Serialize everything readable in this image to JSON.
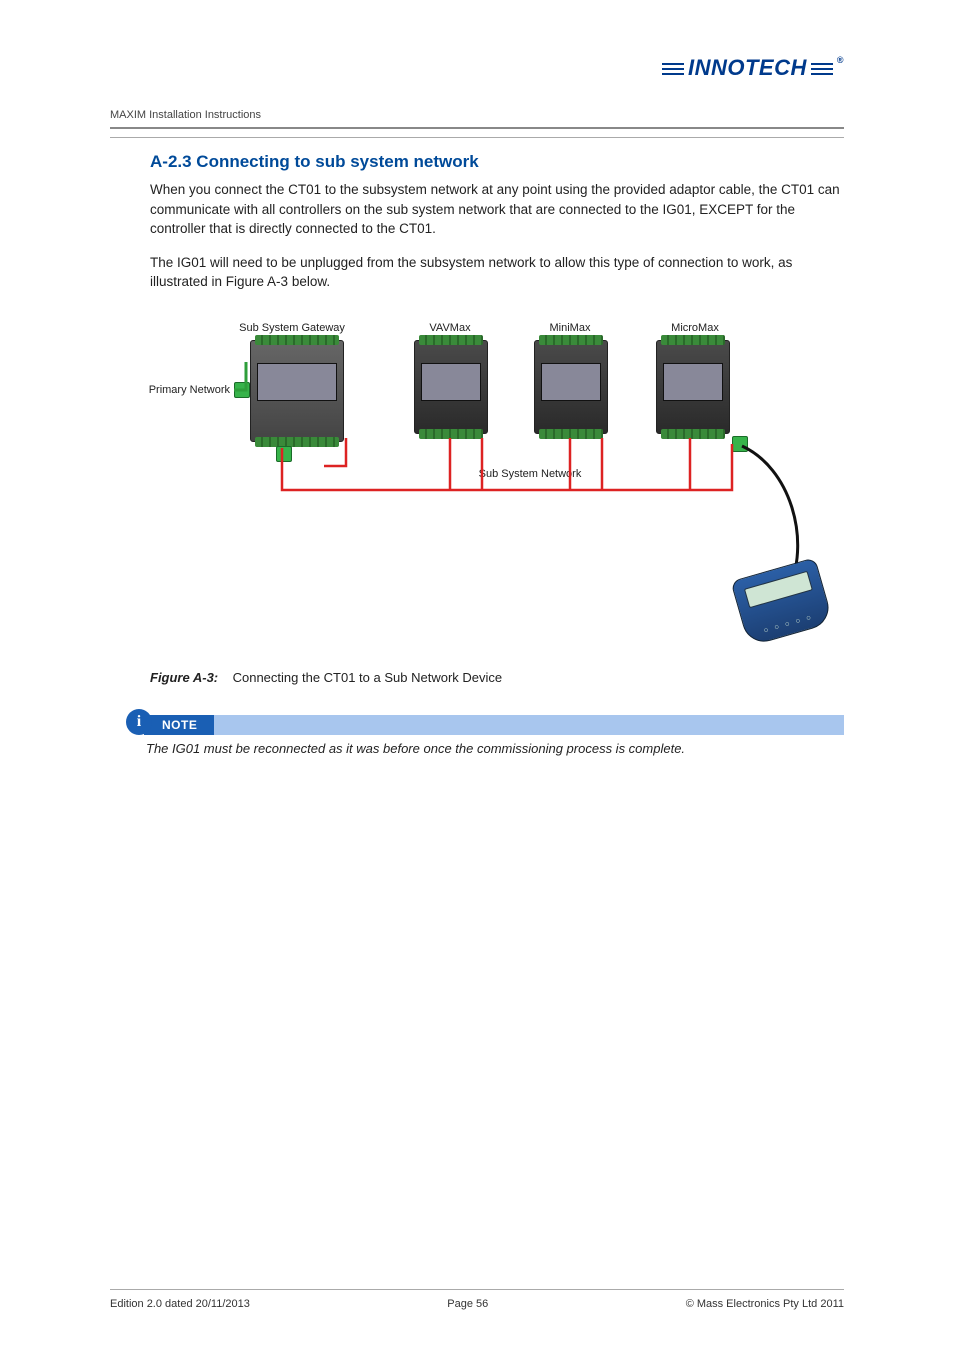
{
  "brand": "INNOTECH",
  "doc_header": "MAXIM Installation Instructions",
  "section": {
    "number_title": "A-2.3  Connecting to sub system network",
    "para1": "When you connect the CT01 to the subsystem network at any point using the provided adaptor cable, the CT01 can communicate with all controllers on the sub system network that are connected to the IG01, EXCEPT for the controller that is directly connected to the CT01.",
    "para2": "The IG01 will need to be unplugged from the subsystem network to allow this type of connection to work, as illustrated in Figure A-3 below."
  },
  "figure": {
    "labels": {
      "gateway": "Sub System Gateway",
      "vavmax": "VAVMax",
      "minimax": "MiniMax",
      "micromax": "MicroMax",
      "primary": "Primary Network",
      "subnet": "Sub System Network"
    },
    "caption_label": "Figure A-3:",
    "caption_text": "Connecting the CT01 to a Sub Network Device"
  },
  "note": {
    "badge": "NOTE",
    "text": "The IG01 must be reconnected as it was before once the commissioning process is complete."
  },
  "footer": {
    "edition": "Edition 2.0 dated 20/11/2013",
    "page": "Page 56",
    "copyright": "©  Mass Electronics Pty Ltd  2011"
  }
}
